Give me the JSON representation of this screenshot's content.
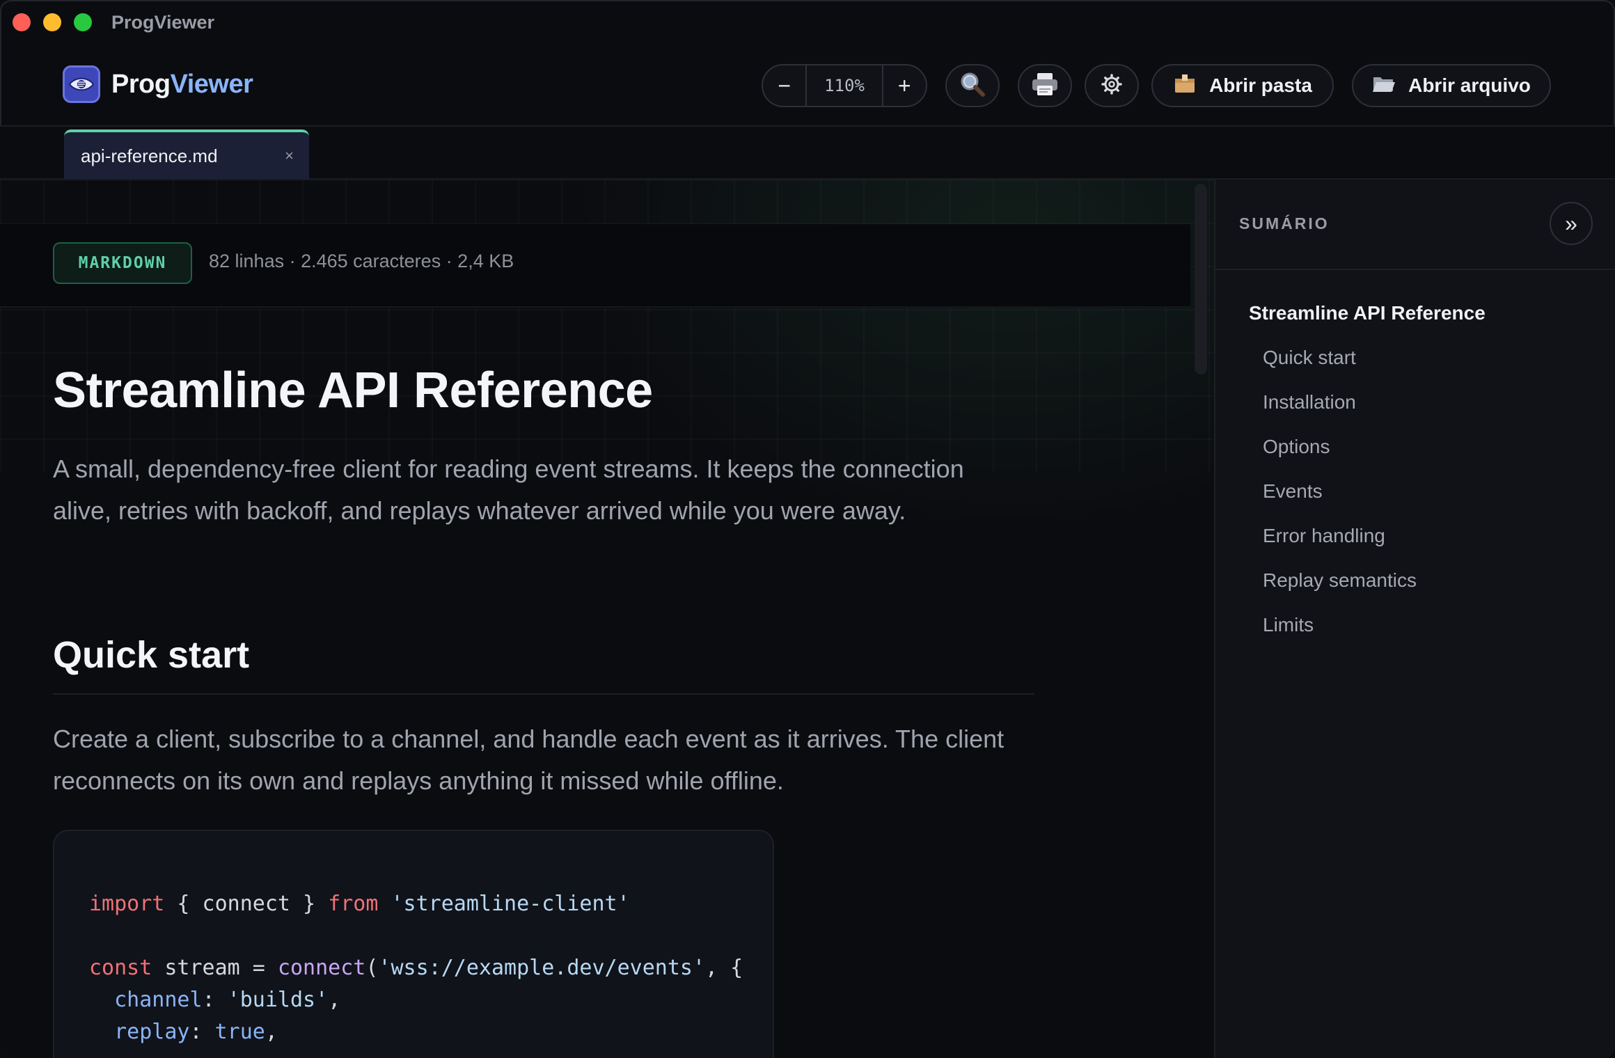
{
  "window": {
    "title": "ProgViewer"
  },
  "brand": {
    "name_part1": "Prog",
    "name_part2": "Viewer"
  },
  "toolbar": {
    "zoom_out_label": "−",
    "zoom_value": "110%",
    "zoom_in_label": "+",
    "search_icon": "magnifier-icon",
    "print_icon": "printer-icon",
    "settings_icon": "gear-icon",
    "open_folder_label": "Abrir pasta",
    "open_file_label": "Abrir arquivo"
  },
  "tabs": [
    {
      "label": "api-reference.md",
      "close": "×"
    }
  ],
  "doc_meta": {
    "badge": "MARKDOWN",
    "stats": "82 linhas · 2.465 caracteres · 2,4 KB"
  },
  "document": {
    "h1": "Streamline API Reference",
    "lead": "A small, dependency-free client for reading event streams. It keeps the connection alive, retries with backoff, and replays whatever arrived while you were away.",
    "h2": "Quick start",
    "para": "Create a client, subscribe to a channel, and handle each event as it arrives. The client reconnects on its own and replays anything it missed while offline.",
    "code": {
      "l1_kw": "import",
      "l1_mid": " { connect } ",
      "l1_kw2": "from",
      "l1_str": " 'streamline-client'",
      "l3_kw": "const",
      "l3_mid": " stream = ",
      "l3_fn": "connect",
      "l3_open": "(",
      "l3_str": "'wss://example.dev/events'",
      "l3_end": ", {",
      "l4_prop": "  channel",
      "l4_mid": ": ",
      "l4_str": "'builds'",
      "l4_end": ",",
      "l5_prop": "  replay",
      "l5_mid": ": ",
      "l5_bool": "true",
      "l5_end": ","
    }
  },
  "sidebar": {
    "title": "SUMÁRIO",
    "collapse_label": "»",
    "toc": [
      {
        "label": "Streamline API Reference"
      },
      {
        "label": "Quick start"
      },
      {
        "label": "Installation"
      },
      {
        "label": "Options"
      },
      {
        "label": "Events"
      },
      {
        "label": "Error handling"
      },
      {
        "label": "Replay semantics"
      },
      {
        "label": "Limits"
      }
    ]
  },
  "colors": {
    "accent_green": "#5fd0a8",
    "accent_blue": "#8ab4f8",
    "background": "#0b0c10"
  }
}
